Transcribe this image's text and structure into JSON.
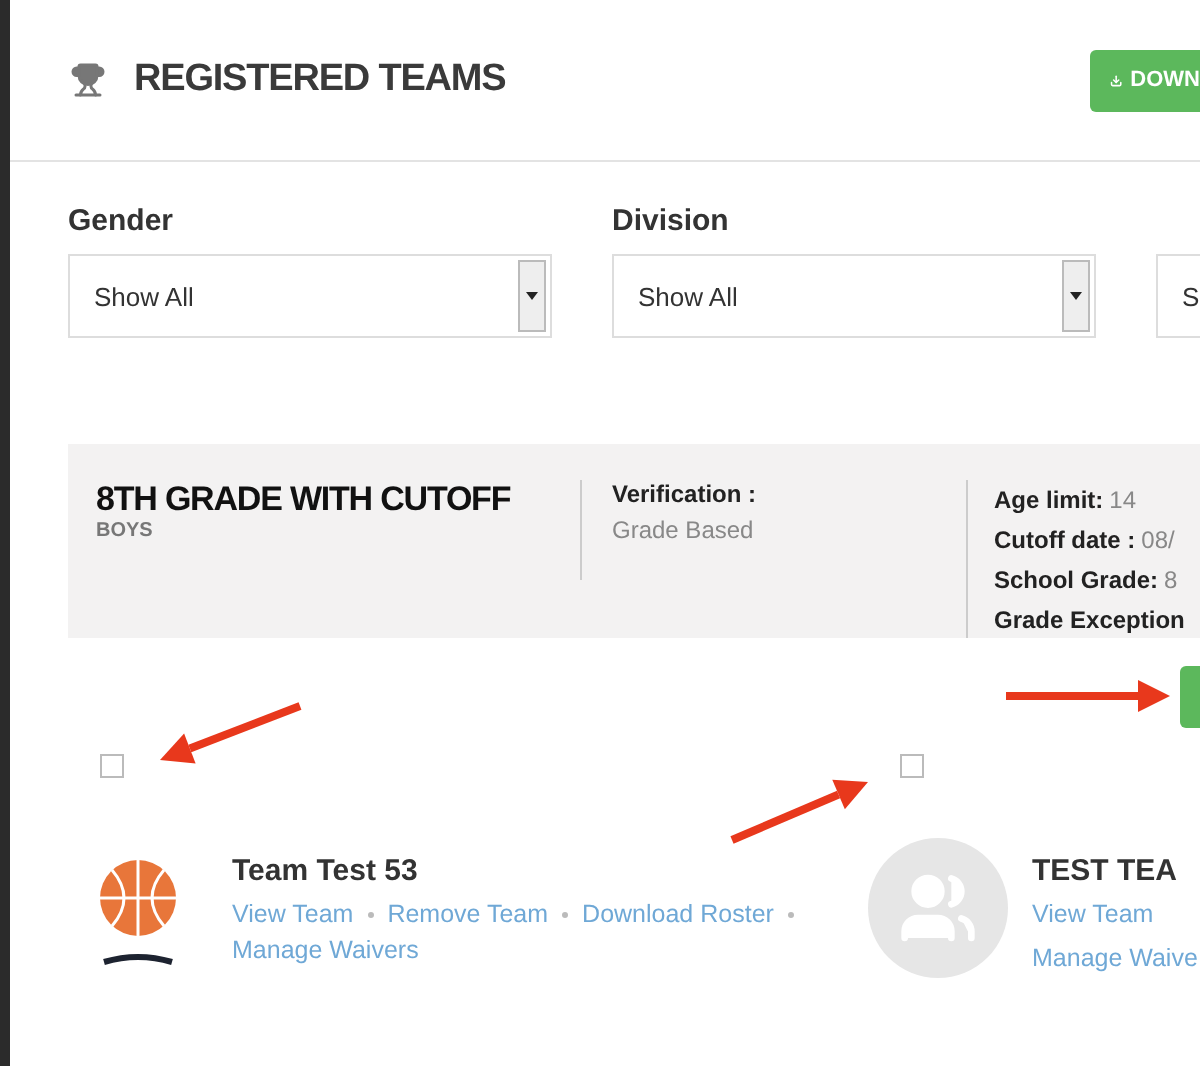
{
  "header": {
    "title": "REGISTERED TEAMS",
    "download_button": "DOWN"
  },
  "filters": [
    {
      "label": "Gender",
      "value": "Show All"
    },
    {
      "label": "Division",
      "value": "Show All"
    },
    {
      "value": "S"
    }
  ],
  "division": {
    "name": "8TH GRADE WITH CUTOFF",
    "gender": "BOYS",
    "verification_label": "Verification :",
    "verification_value": "Grade Based",
    "details": [
      {
        "label": "Age limit:",
        "value": "14"
      },
      {
        "label": "Cutoff date :",
        "value": "08/"
      },
      {
        "label": "School Grade:",
        "value": "8"
      },
      {
        "label": "Grade Exception"
      }
    ]
  },
  "teams": [
    {
      "name": "Team Test 53",
      "checked": false,
      "kind": "logo",
      "links": [
        "View Team",
        "Remove Team",
        "Download Roster",
        "Manage Waivers"
      ]
    },
    {
      "name": "TEST TEA",
      "checked": false,
      "kind": "placeholder",
      "links": [
        "View Team",
        "Manage Waive"
      ]
    }
  ]
}
